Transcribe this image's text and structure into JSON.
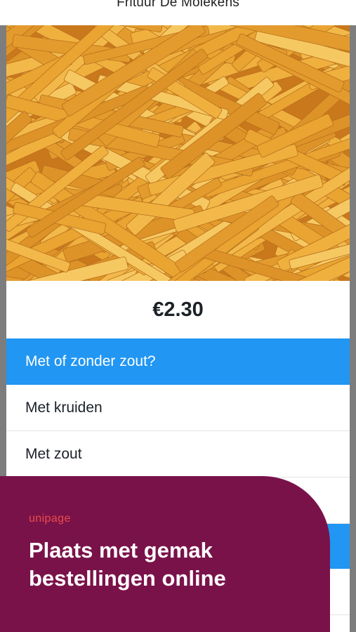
{
  "header": {
    "title": "Frituur De Molekens"
  },
  "product": {
    "image": "french-fries-photo",
    "price": "€2.30"
  },
  "options": {
    "group_title": "Met of zonder zout?",
    "items": [
      "Met kruiden",
      "Met zout"
    ]
  },
  "promo": {
    "brand": "unipage",
    "headline_line1": "Plaats met gemak",
    "headline_line2": "bestellingen online"
  },
  "colors": {
    "accent_blue": "#2196f3",
    "promo_bg": "#7a124a",
    "brand_red": "#ea4c4c",
    "fries_gold": "#e9a431"
  }
}
